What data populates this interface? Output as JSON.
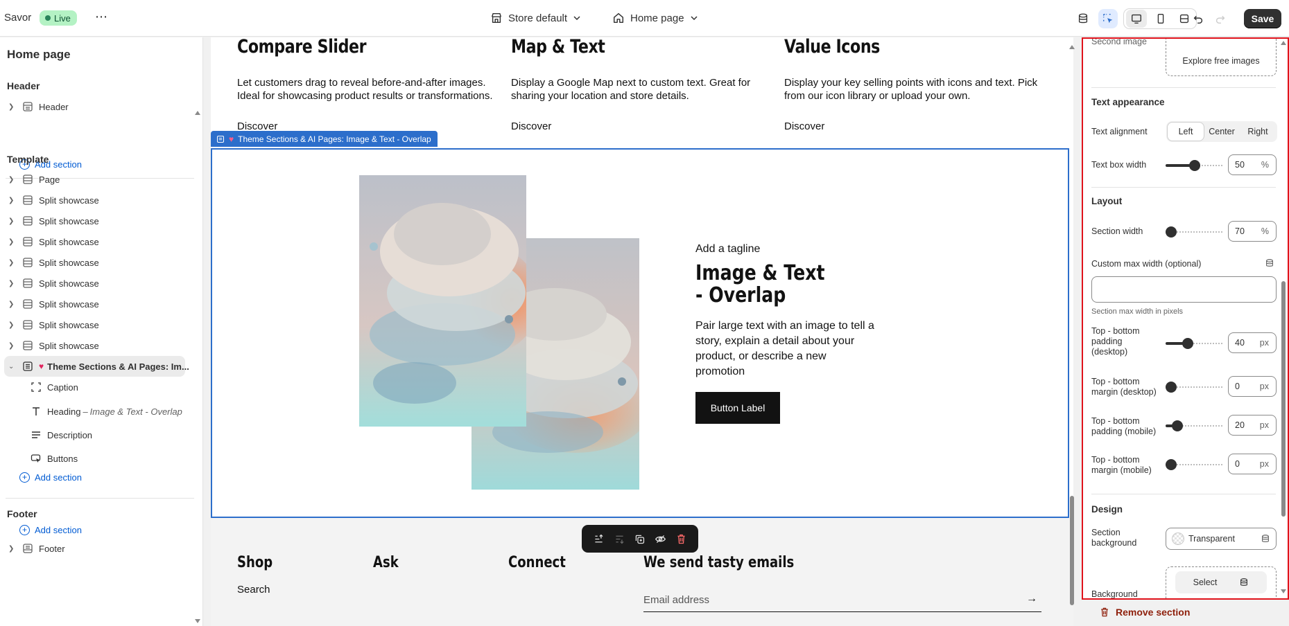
{
  "topbar": {
    "store_name": "Savor",
    "live_badge": "Live",
    "more_label": "⋯",
    "store_selector": "Store default",
    "page_selector": "Home page",
    "save_label": "Save"
  },
  "sidebar": {
    "title": "Home page",
    "header_group": "Header",
    "header_items": [
      "Header"
    ],
    "add_section": "Add section",
    "template_group": "Template",
    "template_items": [
      "Page",
      "Split showcase",
      "Split showcase",
      "Split showcase",
      "Split showcase",
      "Split showcase",
      "Split showcase",
      "Split showcase",
      "Split showcase"
    ],
    "selected_section": "Theme Sections & AI Pages: Im...",
    "children": {
      "caption": "Caption",
      "heading": "Heading",
      "heading_sub": "Image & Text - Overlap",
      "description": "Description",
      "buttons": "Buttons"
    },
    "footer_group": "Footer",
    "footer_items": [
      "Footer"
    ]
  },
  "preview": {
    "features": [
      {
        "title": "Compare Slider",
        "desc": "Let customers drag to reveal before-and-after images. Ideal for showcasing product results or transformations.",
        "link": "Discover"
      },
      {
        "title": "Map & Text",
        "desc": "Display a Google Map next to custom text. Great for sharing your location and store details.",
        "link": "Discover"
      },
      {
        "title": "Value Icons",
        "desc": "Display your key selling points with icons and text. Pick from our icon library or upload your own.",
        "link": "Discover"
      }
    ],
    "selection_tag": "Theme Sections & AI Pages: Image & Text - Overlap",
    "overlap": {
      "tagline": "Add a tagline",
      "heading": "Image & Text - Overlap",
      "description": "Pair large text with an image to tell a story, explain a detail about your product, or describe a new promotion",
      "button": "Button Label"
    },
    "footer": {
      "headings": [
        "Shop",
        "Ask",
        "Connect",
        "We send tasty emails"
      ],
      "shop_link": "Search",
      "email_placeholder": "Email address",
      "arrow": "→"
    }
  },
  "settings": {
    "second_image_label": "Second image",
    "explore_images": "Explore free images",
    "text_appearance": "Text appearance",
    "text_alignment_label": "Text alignment",
    "alignment_options": [
      "Left",
      "Center",
      "Right"
    ],
    "alignment_selected": "Left",
    "text_box_width_label": "Text box width",
    "text_box_width": {
      "value": "50",
      "unit": "%",
      "fraction": 0.5
    },
    "layout": "Layout",
    "section_width_label": "Section width",
    "section_width": {
      "value": "70",
      "unit": "%",
      "fraction": 0.0
    },
    "custom_max_width_label": "Custom max width (optional)",
    "custom_max_width_help": "Section max width in pixels",
    "padding_desktop_label": "Top - bottom padding (desktop)",
    "padding_desktop": {
      "value": "40",
      "unit": "px",
      "fraction": 0.35
    },
    "margin_desktop_label": "Top - bottom margin (desktop)",
    "margin_desktop": {
      "value": "0",
      "unit": "px",
      "fraction": 0.0
    },
    "padding_mobile_label": "Top - bottom padding (mobile)",
    "padding_mobile": {
      "value": "20",
      "unit": "px",
      "fraction": 0.13
    },
    "margin_mobile_label": "Top - bottom margin (mobile)",
    "margin_mobile": {
      "value": "0",
      "unit": "px",
      "fraction": 0.0
    },
    "design": "Design",
    "section_background_label": "Section background",
    "section_background_value": "Transparent",
    "background_label": "Background",
    "select_label": "Select",
    "remove_section": "Remove section"
  },
  "colors": {
    "accent": "#2c6ecb",
    "link": "#005bd3",
    "danger": "#8e1f0b",
    "highlight_border": "#e0121b"
  }
}
